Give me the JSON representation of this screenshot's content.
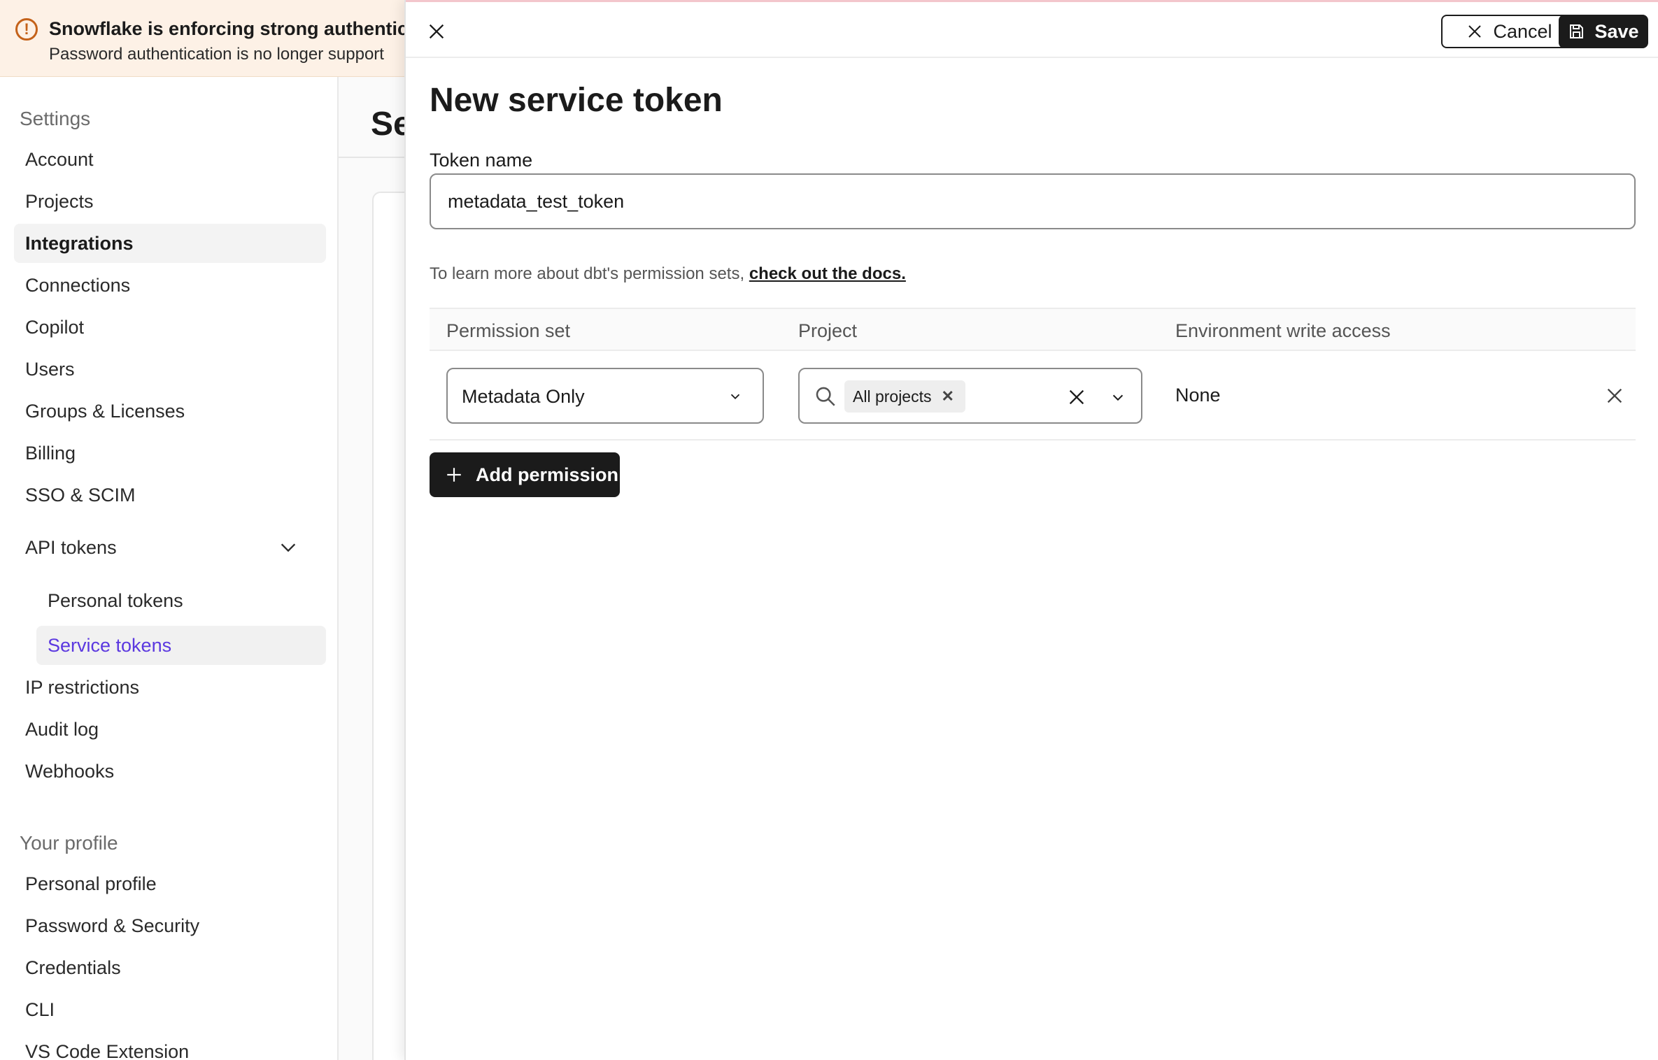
{
  "banner": {
    "title": "Snowflake is enforcing strong authenticat",
    "subtitle": "Password authentication is no longer support"
  },
  "sidebar": {
    "settings_heading": "Settings",
    "items": [
      {
        "label": "Account"
      },
      {
        "label": "Projects"
      },
      {
        "label": "Integrations"
      },
      {
        "label": "Connections"
      },
      {
        "label": "Copilot"
      },
      {
        "label": "Users"
      },
      {
        "label": "Groups & Licenses"
      },
      {
        "label": "Billing"
      },
      {
        "label": "SSO & SCIM"
      },
      {
        "label": "API tokens"
      },
      {
        "label": "IP restrictions"
      },
      {
        "label": "Audit log"
      },
      {
        "label": "Webhooks"
      }
    ],
    "api_tokens_sub": [
      {
        "label": "Personal tokens"
      },
      {
        "label": "Service tokens"
      }
    ],
    "profile_heading": "Your profile",
    "profile_items": [
      {
        "label": "Personal profile"
      },
      {
        "label": "Password & Security"
      },
      {
        "label": "Credentials"
      },
      {
        "label": "CLI"
      },
      {
        "label": "VS Code Extension"
      }
    ]
  },
  "main": {
    "title_partial": "Se"
  },
  "drawer": {
    "cancel_label": "Cancel",
    "save_label": "Save",
    "title": "New service token",
    "token_name_label": "Token name",
    "token_name_value": "metadata_test_token",
    "docs_text": "To learn more about dbt's permission sets,",
    "docs_link": "check out the docs.",
    "table": {
      "headers": [
        "Permission set",
        "Project",
        "Environment write access"
      ],
      "rows": [
        {
          "permission_set": "Metadata Only",
          "project_chip": "All projects",
          "environment_write_access": "None"
        }
      ]
    },
    "add_permission_label": "Add permission"
  },
  "colors": {
    "accent_purple": "#5b38e0",
    "banner_bg": "#fdf1e6",
    "banner_icon": "#c4621a",
    "dark_button": "#1b1b1b"
  },
  "icons": [
    "warning-icon",
    "chevron-down-icon",
    "close-icon",
    "save-icon",
    "search-icon",
    "plus-icon"
  ]
}
